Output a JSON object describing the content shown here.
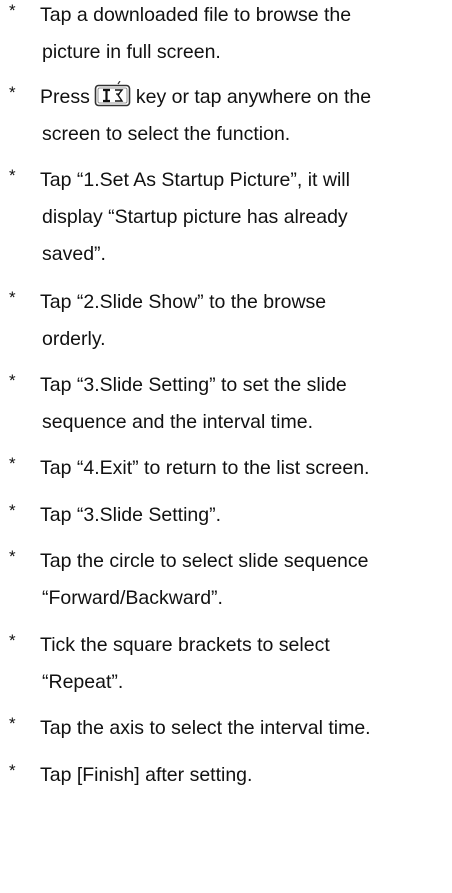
{
  "bullet": "*",
  "items": [
    {
      "lines": [
        "Tap a downloaded file to browse the",
        "picture in full screen."
      ]
    },
    {
      "before_icon": "Press",
      "icon": "menu-key-icon",
      "after_icon": "key or tap anywhere on the",
      "lines": [
        "screen to select the function."
      ]
    },
    {
      "lines": [
        "Tap “1.Set As Startup Picture”, it will",
        "display “Startup picture has already",
        "saved”."
      ]
    },
    {
      "lines": [
        "Tap “2.Slide Show” to the browse",
        "orderly."
      ]
    },
    {
      "lines": [
        "Tap “3.Slide Setting” to set the slide",
        "sequence and the interval time."
      ]
    },
    {
      "lines": [
        "Tap “4.Exit” to return to the list screen."
      ]
    },
    {
      "lines": [
        "Tap “3.Slide Setting”."
      ]
    },
    {
      "lines": [
        "Tap the circle to select slide sequence",
        "“Forward/Backward”."
      ]
    },
    {
      "lines": [
        "Tick the square brackets to select",
        "“Repeat”."
      ]
    },
    {
      "lines": [
        "Tap the axis to select the interval time."
      ]
    },
    {
      "lines": [
        "Tap [Finish] after setting."
      ]
    }
  ]
}
